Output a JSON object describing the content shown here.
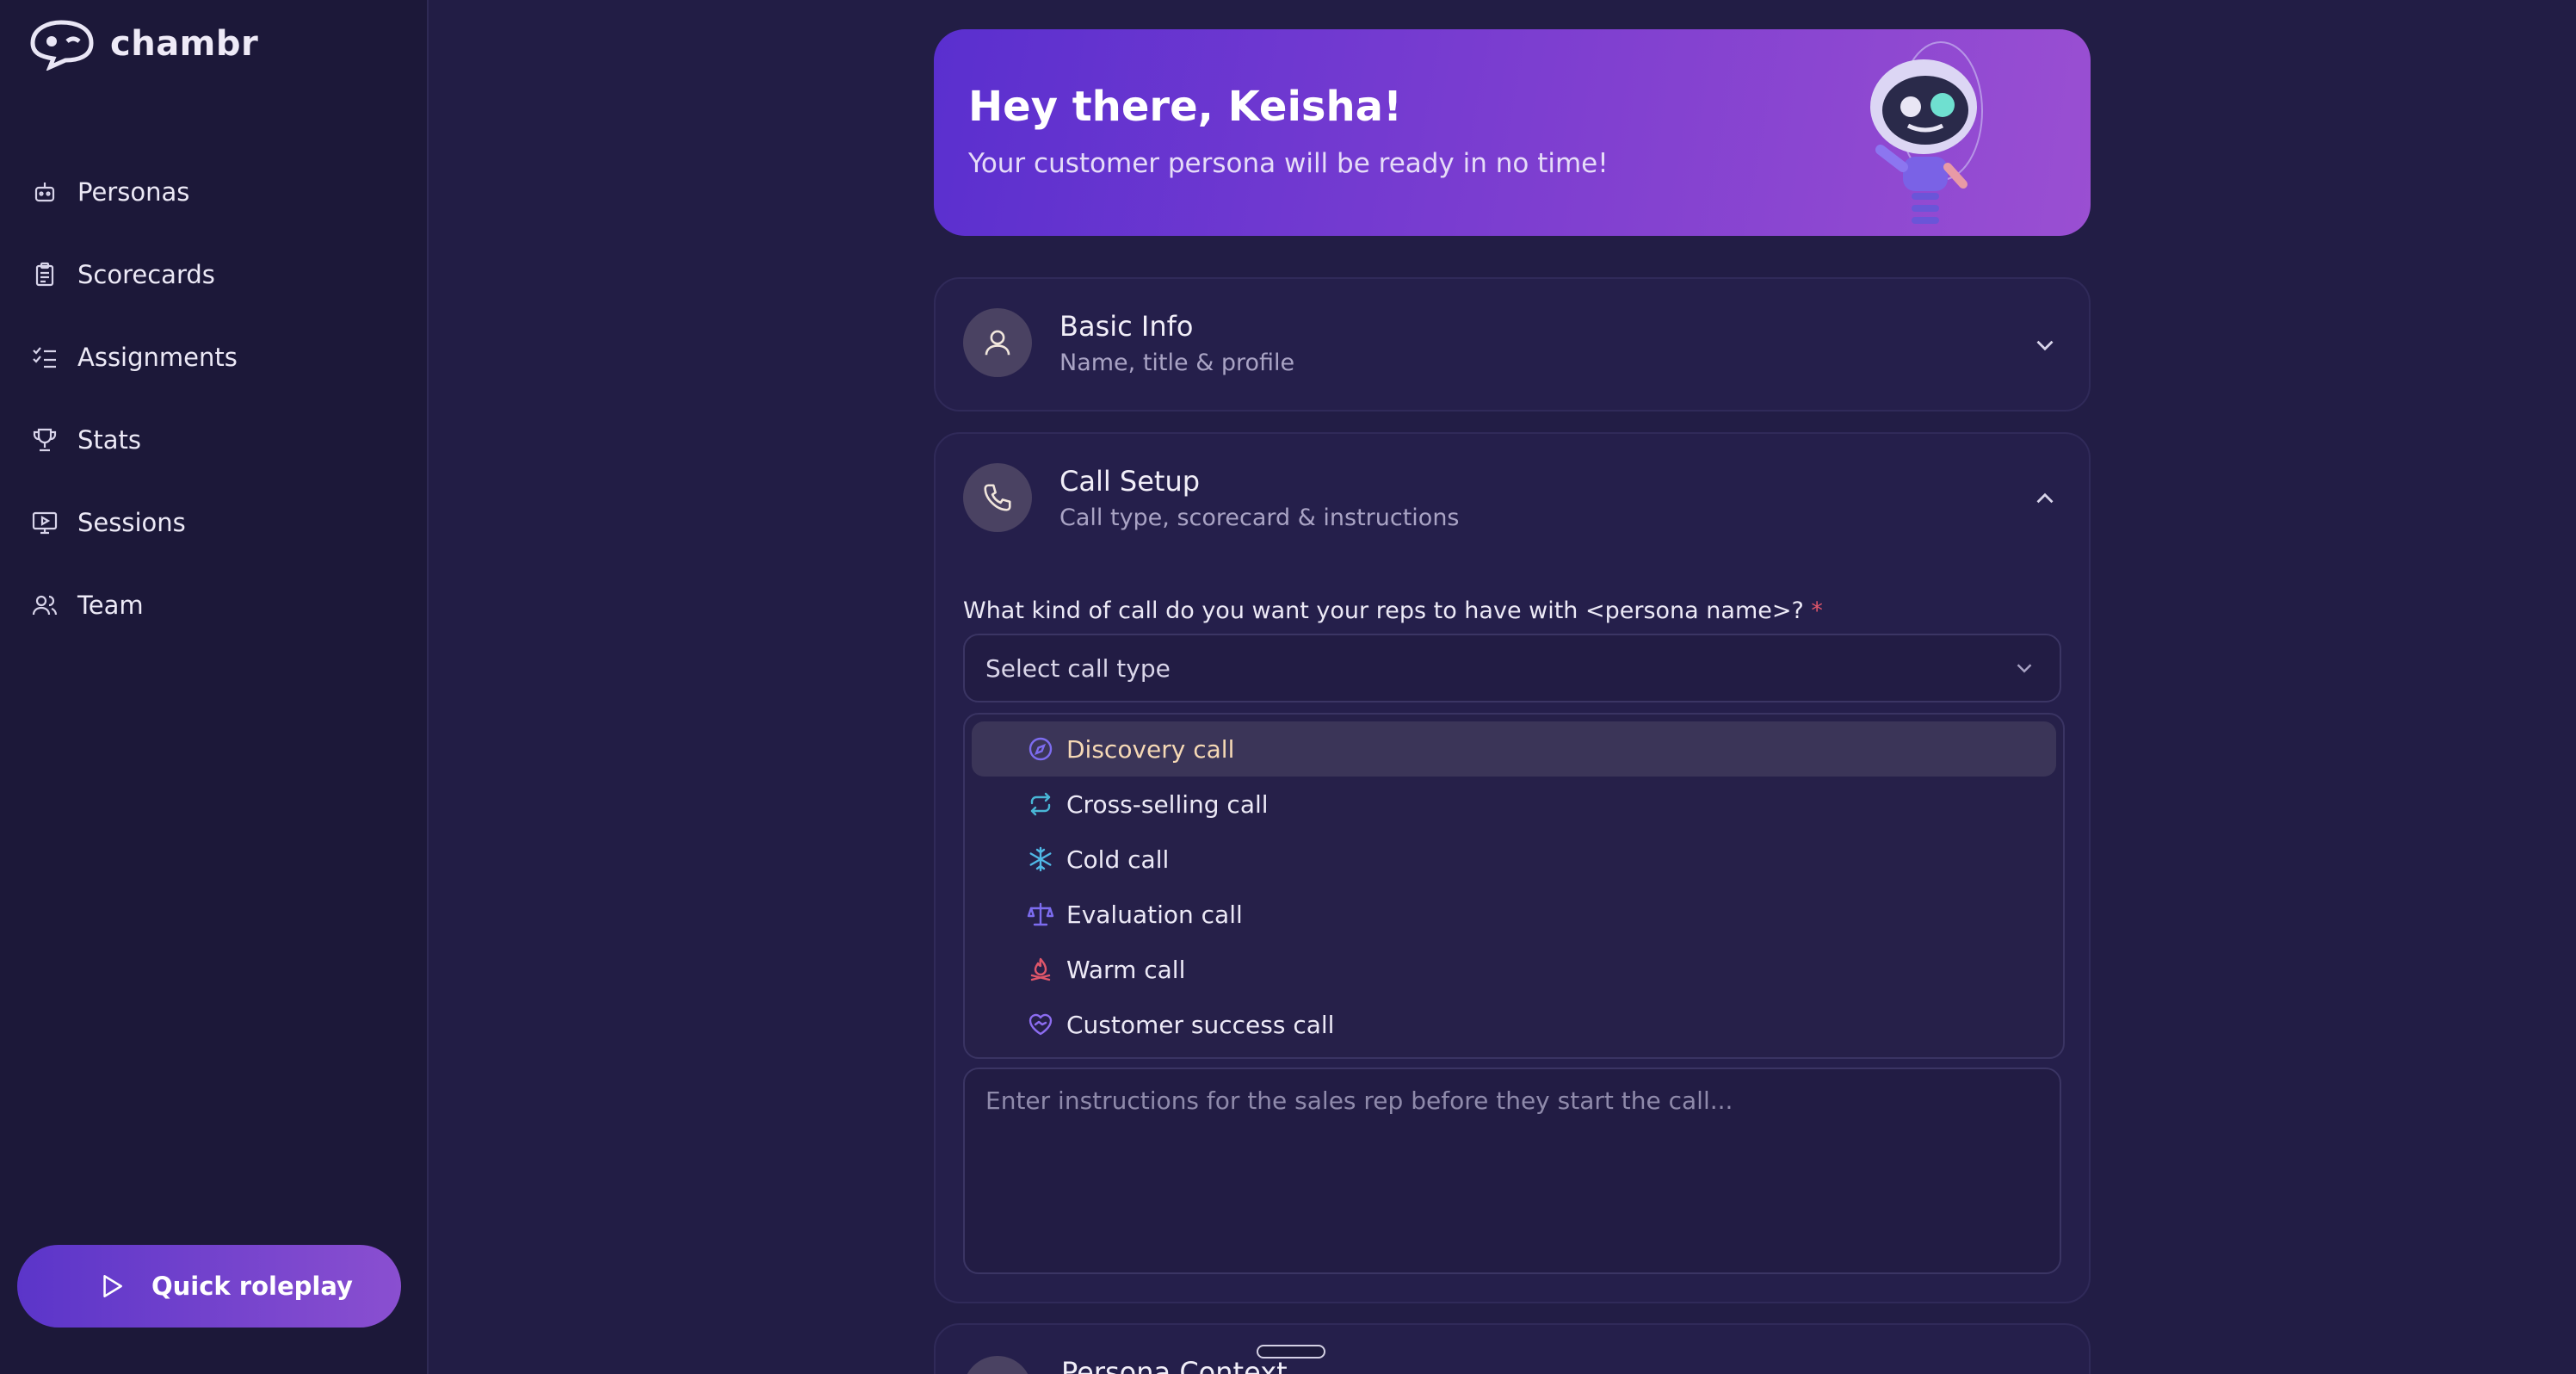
{
  "app": {
    "logo_text": "chambr"
  },
  "sidebar": {
    "items": [
      {
        "label": "Personas",
        "icon": "robot-icon"
      },
      {
        "label": "Scorecards",
        "icon": "clipboard-icon"
      },
      {
        "label": "Assignments",
        "icon": "checklist-icon"
      },
      {
        "label": "Stats",
        "icon": "trophy-icon"
      },
      {
        "label": "Sessions",
        "icon": "presentation-icon"
      },
      {
        "label": "Team",
        "icon": "users-icon"
      }
    ],
    "quick_roleplay_label": "Quick roleplay"
  },
  "hero": {
    "title": "Hey there, Keisha!",
    "subtitle": "Your customer persona will be ready in no time!"
  },
  "basic_info": {
    "title": "Basic Info",
    "subtitle": "Name, title & profile"
  },
  "call_setup": {
    "title": "Call Setup",
    "subtitle": "Call type, scorecard & instructions",
    "question": "What kind of call do you want your reps to have with <persona name>?",
    "required_marker": "*",
    "select_placeholder": "Select call type",
    "options": [
      {
        "label": "Discovery call",
        "icon": "compass-icon",
        "color": "#7d6cf0"
      },
      {
        "label": "Cross-selling call",
        "icon": "repeat-icon",
        "color": "#49b6d6"
      },
      {
        "label": "Cold call",
        "icon": "snowflake-icon",
        "color": "#4fb8e6"
      },
      {
        "label": "Evaluation call",
        "icon": "scale-icon",
        "color": "#7d6cf0"
      },
      {
        "label": "Warm call",
        "icon": "campfire-icon",
        "color": "#e0566a"
      },
      {
        "label": "Customer success call",
        "icon": "heart-handshake-icon",
        "color": "#8c6cf0"
      }
    ],
    "instructions_placeholder": "Enter instructions for the sales rep before they start the call..."
  },
  "persona_context": {
    "title": "Persona Context"
  },
  "colors": {
    "background": "#221d45",
    "sidebar": "#1c1839",
    "accent": "#6a3cd4",
    "required": "#e0566a"
  }
}
